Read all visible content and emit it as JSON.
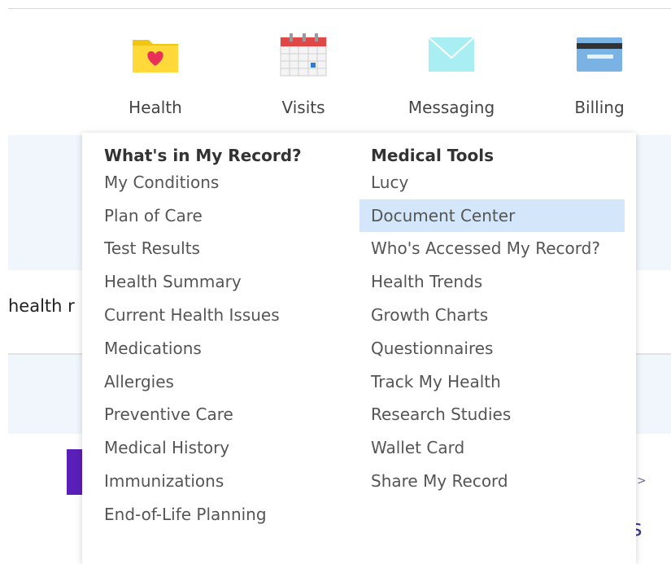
{
  "nav": {
    "items": [
      {
        "label": "Health",
        "icon": "health-folder-icon"
      },
      {
        "label": "Visits",
        "icon": "calendar-icon"
      },
      {
        "label": "Messaging",
        "icon": "envelope-icon"
      },
      {
        "label": "Billing",
        "icon": "credit-card-icon"
      }
    ]
  },
  "background": {
    "partial_text": "health r",
    "arrow": ">",
    "partial_letter": "s"
  },
  "menu": {
    "left": {
      "heading": "What's in My Record?",
      "items": [
        "My Conditions",
        "Plan of Care",
        "Test Results",
        "Health Summary",
        "Current Health Issues",
        "Medications",
        "Allergies",
        "Preventive Care",
        "Medical History",
        "Immunizations",
        "End-of-Life Planning"
      ]
    },
    "right": {
      "heading": "Medical Tools",
      "items": [
        "Lucy",
        "Document Center",
        "Who's Accessed My Record?",
        "Health Trends",
        "Growth Charts",
        "Questionnaires",
        "Track My Health",
        "Research Studies",
        "Wallet Card",
        "Share My Record"
      ],
      "selected": "Document Center"
    }
  },
  "colors": {
    "highlight": "#d3e6fa",
    "band": "#f1f6fd",
    "accent_purple": "#5a1fb8"
  }
}
